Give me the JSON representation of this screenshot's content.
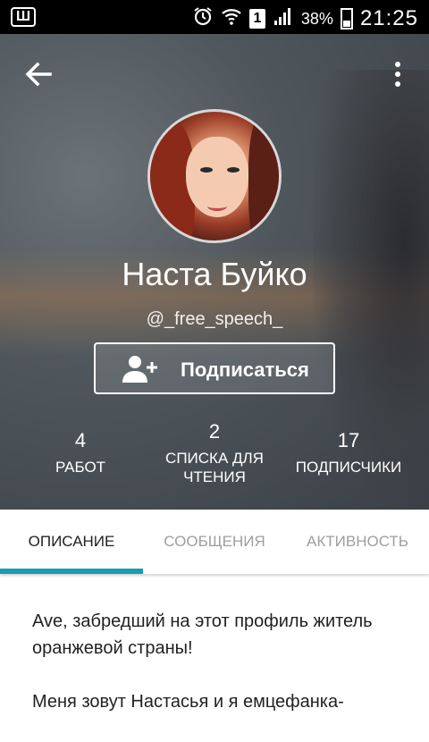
{
  "status_bar": {
    "app_badge": "Ш",
    "sim_slot": "1",
    "battery_percent": "38%",
    "time": "21:25"
  },
  "profile": {
    "name": "Наста Буйко",
    "username": "@_free_speech_",
    "follow_label": "Подписаться"
  },
  "stats": [
    {
      "value": "4",
      "label": "РАБОТ"
    },
    {
      "value": "2",
      "label": "СПИСКА ДЛЯ ЧТЕНИЯ"
    },
    {
      "value": "17",
      "label": "ПОДПИСЧИКИ"
    }
  ],
  "tabs": [
    {
      "label": "ОПИСАНИЕ",
      "active": true
    },
    {
      "label": "СООБЩЕНИЯ",
      "active": false
    },
    {
      "label": "АКТИВНОСТЬ",
      "active": false
    }
  ],
  "description": {
    "paragraph1": "Ave, забредший на этот профиль житель оранжевой страны!",
    "paragraph2": "Меня зовут Настасья и я емцефанка-"
  },
  "colors": {
    "tab_indicator": "#1a9bb0",
    "status_bar": "#000000"
  }
}
